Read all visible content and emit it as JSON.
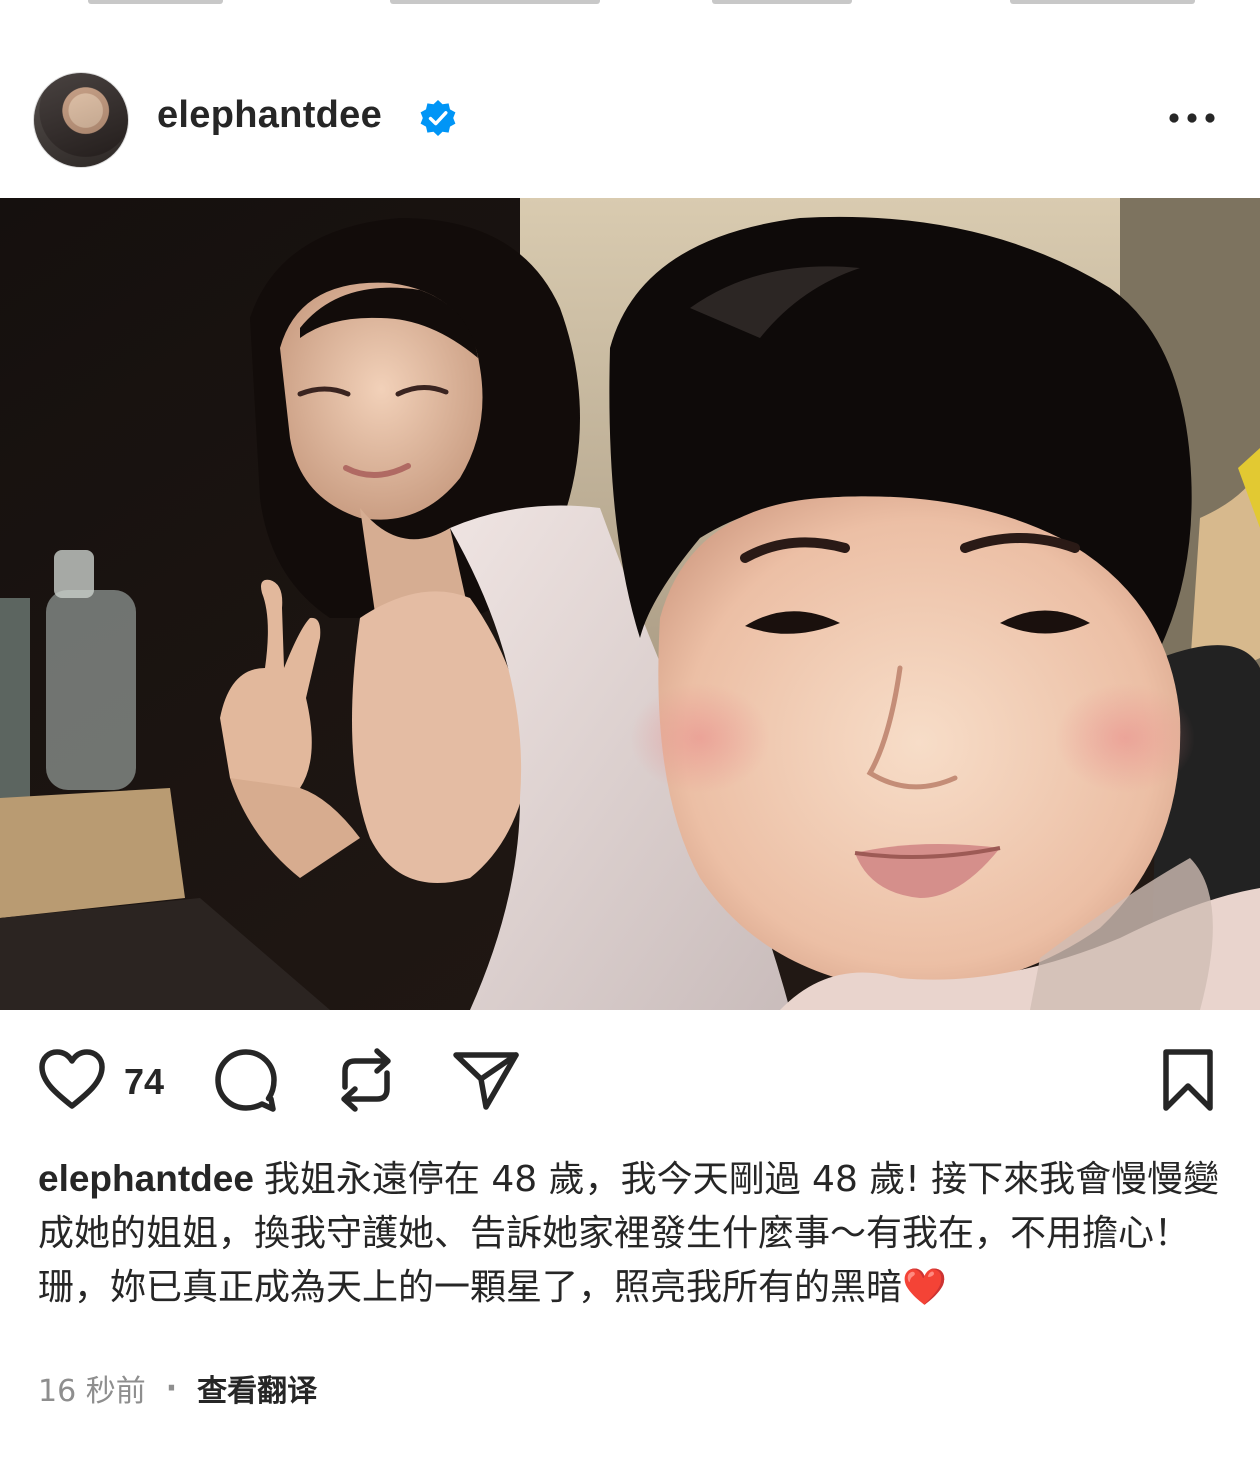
{
  "post": {
    "username": "elephantdee",
    "verified": true,
    "likes": "74",
    "caption_user": "elephantdee",
    "caption_text": "我姐永遠停在 48 歲，我今天剛過 48 歲! 接下來我會慢慢變成她的姐姐，換我守護她、告訴她家裡發生什麼事～有我在，不用擔心！珊，妳已真正成為天上的一顆星了，照亮我所有的黑暗",
    "caption_emoji": "❤️",
    "time_ago": "16 秒前",
    "separator": "·",
    "translate_label": "查看翻译"
  },
  "icons": {
    "more": "more-horizontal-icon",
    "verified": "verified-badge-icon",
    "like": "heart-icon",
    "comment": "comment-icon",
    "repost": "repost-icon",
    "share": "send-icon",
    "save": "bookmark-icon"
  },
  "colors": {
    "text": "#262626",
    "secondary": "#8e8e8e",
    "verified": "#0095f6",
    "heart_emoji": "#e0242e"
  }
}
